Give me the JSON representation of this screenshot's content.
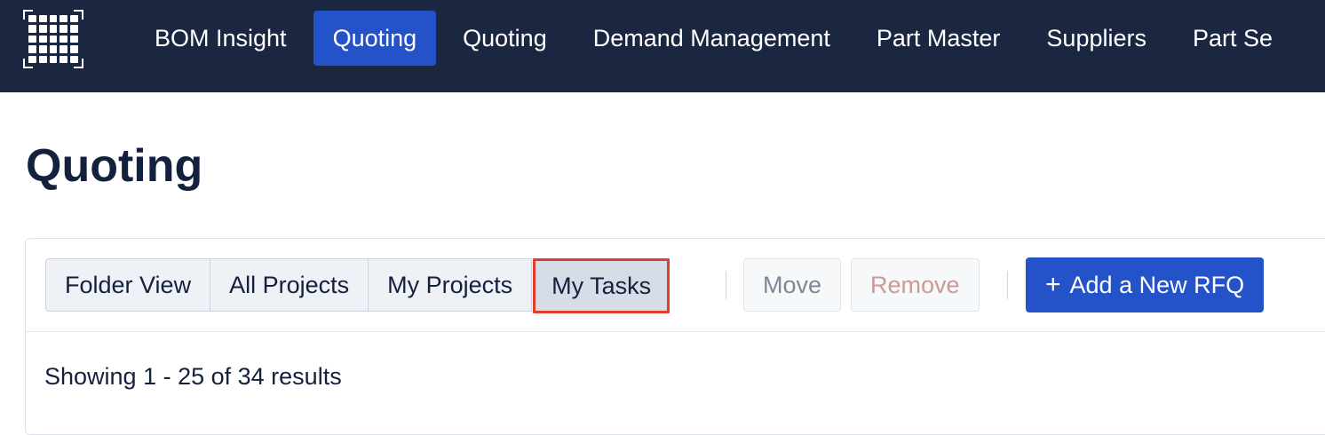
{
  "topbar": {
    "logo_icon": "grid-logo-icon",
    "nav": [
      {
        "label": "BOM Insight",
        "active": false
      },
      {
        "label": "Quoting",
        "active": true
      },
      {
        "label": "Quoting",
        "active": false
      },
      {
        "label": "Demand Management",
        "active": false
      },
      {
        "label": "Part Master",
        "active": false
      },
      {
        "label": "Suppliers",
        "active": false
      },
      {
        "label": "Part Se",
        "active": false
      }
    ]
  },
  "page": {
    "title": "Quoting"
  },
  "toolbar": {
    "view_buttons": [
      "Folder View",
      "All Projects",
      "My Projects",
      "My Tasks"
    ],
    "move_label": "Move",
    "remove_label": "Remove",
    "add_label": "Add a New RFQ",
    "add_icon": "plus-icon"
  },
  "results": {
    "summary": "Showing 1 - 25 of 34 results"
  },
  "colors": {
    "topbar_bg": "#1b2640",
    "accent": "#2453c9",
    "highlight_border": "#e0402b"
  }
}
